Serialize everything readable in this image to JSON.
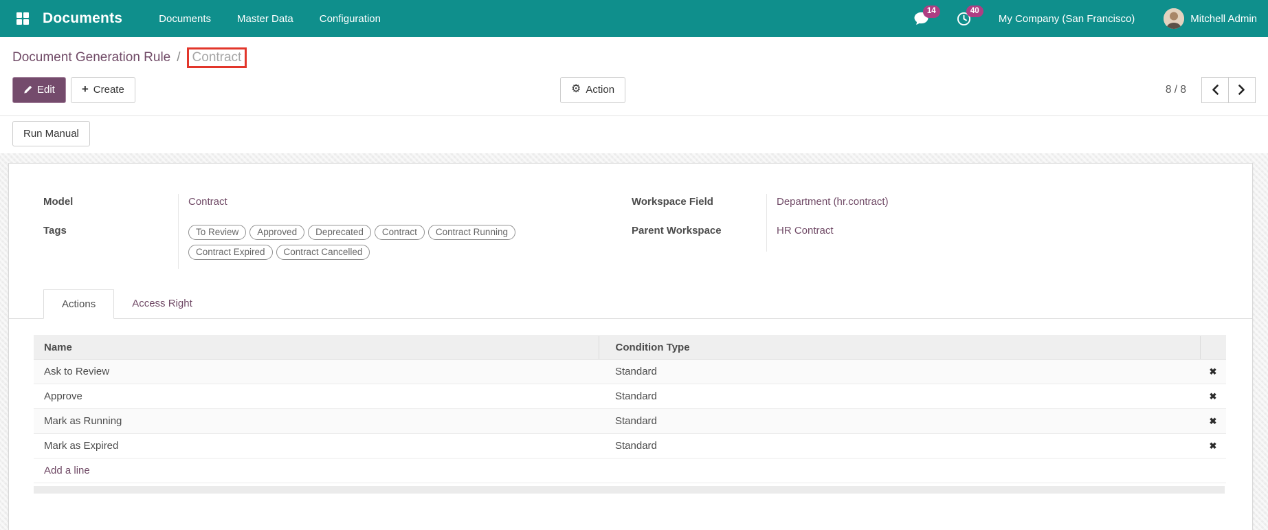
{
  "colors": {
    "topbar": "#0F8F8C",
    "primary": "#714B67",
    "badge": "#AE3E83",
    "annotation": "#E2362B"
  },
  "topbar": {
    "app_name": "Documents",
    "menus": [
      "Documents",
      "Master Data",
      "Configuration"
    ],
    "messages_badge": "14",
    "activities_badge": "40",
    "company": "My Company (San Francisco)",
    "user": "Mitchell Admin"
  },
  "breadcrumb": {
    "parent": "Document Generation Rule",
    "separator": "/",
    "current": "Contract"
  },
  "control_panel": {
    "edit": "Edit",
    "create": "Create",
    "action": "Action",
    "pager": "8 / 8",
    "run_manual": "Run Manual"
  },
  "icons": {
    "apps": "apps-grid-icon",
    "messages": "chat-bubble-icon",
    "activities": "clock-icon",
    "edit": "pencil-icon",
    "create": "plus-icon",
    "action": "gear-icon",
    "prev": "chevron-left-icon",
    "next": "chevron-right-icon",
    "delete": "x-delete-icon",
    "plus_glyph": "+",
    "gear_glyph": "⚙",
    "delete_glyph": "✖"
  },
  "form": {
    "model": {
      "label": "Model",
      "value": "Contract"
    },
    "tags": {
      "label": "Tags",
      "values": [
        "To Review",
        "Approved",
        "Deprecated",
        "Contract",
        "Contract Running",
        "Contract Expired",
        "Contract Cancelled"
      ]
    },
    "workspace_field": {
      "label": "Workspace Field",
      "value": "Department (hr.contract)"
    },
    "parent_workspace": {
      "label": "Parent Workspace",
      "value": "HR Contract"
    },
    "tabs": [
      {
        "label": "Actions",
        "active": true
      },
      {
        "label": "Access Right",
        "active": false
      }
    ],
    "table": {
      "columns": [
        "Name",
        "Condition Type"
      ],
      "rows": [
        {
          "name": "Ask to Review",
          "condition_type": "Standard"
        },
        {
          "name": "Approve",
          "condition_type": "Standard"
        },
        {
          "name": "Mark as Running",
          "condition_type": "Standard"
        },
        {
          "name": "Mark as Expired",
          "condition_type": "Standard"
        }
      ],
      "add_line": "Add a line"
    }
  }
}
